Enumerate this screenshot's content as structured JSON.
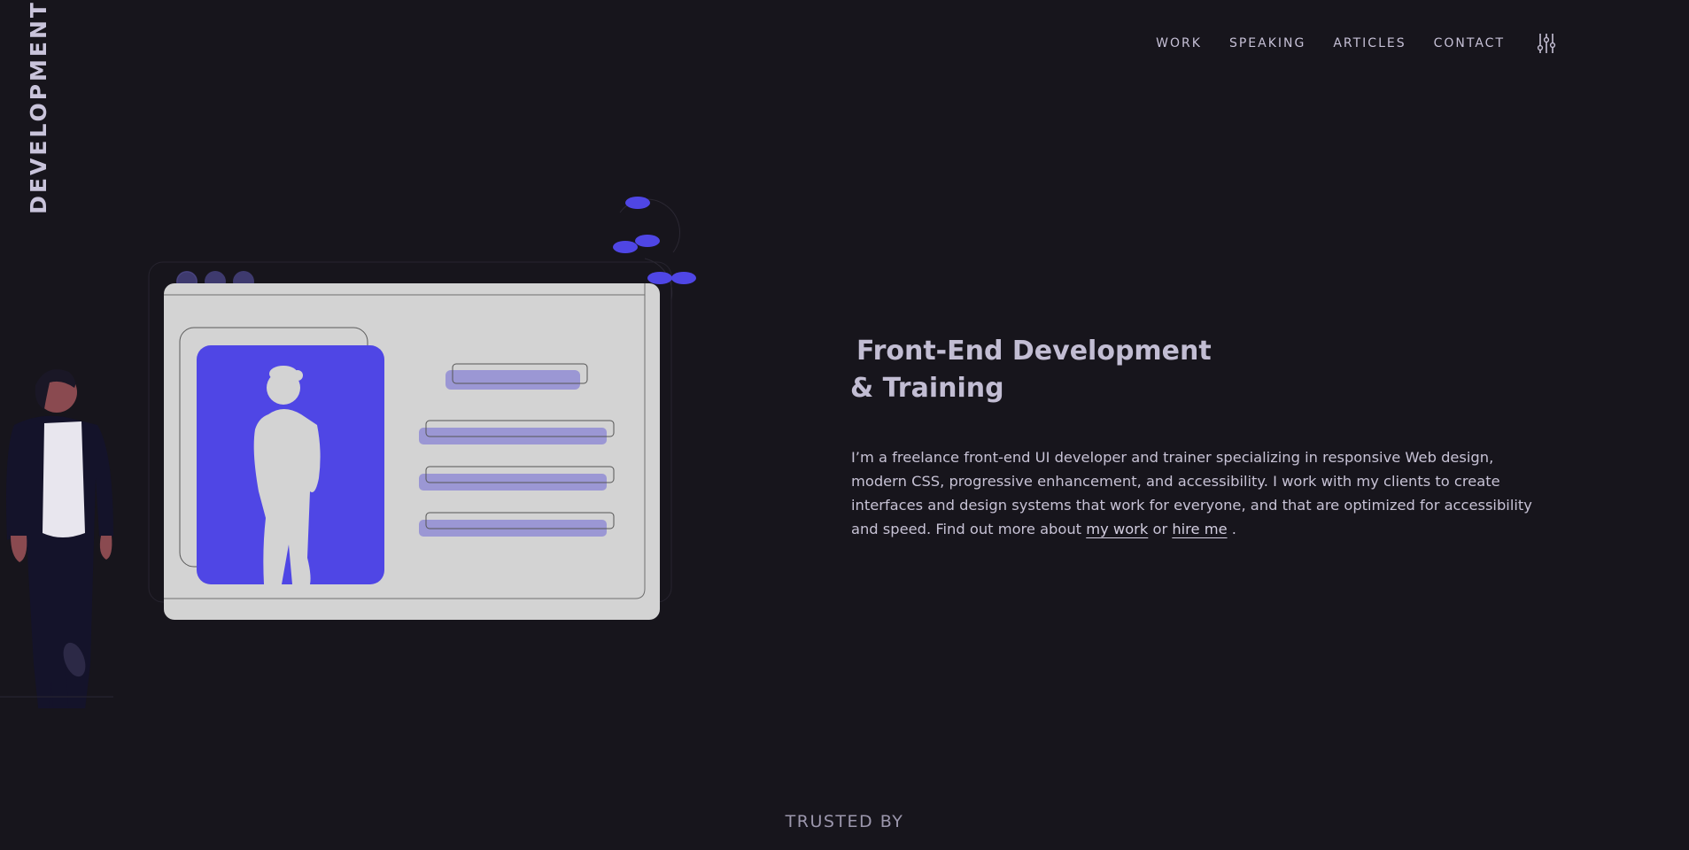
{
  "brand": {
    "vertical_text": "DEVELOPMENT"
  },
  "nav": {
    "items": [
      {
        "label": "WORK"
      },
      {
        "label": "SPEAKING"
      },
      {
        "label": "ARTICLES"
      },
      {
        "label": "CONTACT"
      }
    ],
    "settings_icon": "sliders-icon"
  },
  "hero": {
    "title_line1": "Front-End Development",
    "title_line2": "& Training",
    "intro_before_links": "I’m a freelance front-end UI developer and trainer specializing in responsive Web design, modern CSS, progressive enhancement, and accessibility. I work with my clients to create interfaces and design systems that work for everyone, and that are optimized for accessibility and speed. Find out more about",
    "link_work": "my work",
    "link_join": "or",
    "link_hire": "hire me",
    "intro_after_links": "."
  },
  "footer_strip": {
    "trusted_label": "TRUSTED BY"
  },
  "colors": {
    "background": "#17151c",
    "accent": "#4f46e5",
    "accent_soft": "#9b97d4",
    "text": "#c7c2d5",
    "card": "#d3d3d3"
  }
}
